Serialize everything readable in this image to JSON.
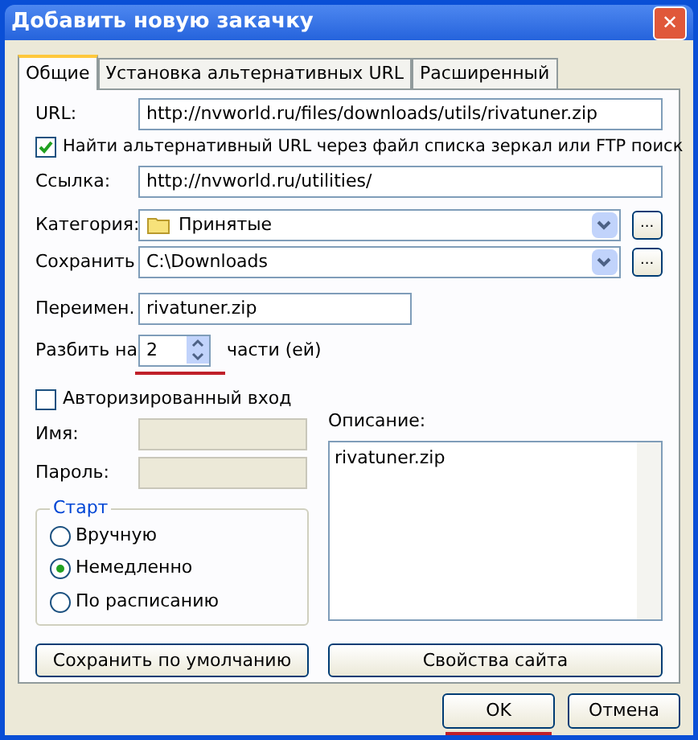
{
  "window": {
    "title": "Добавить новую закачку",
    "close": "✕"
  },
  "tabs": [
    {
      "label": "Общие",
      "selected": true
    },
    {
      "label": "Установка альтернативных URL",
      "selected": false
    },
    {
      "label": "Расширенный",
      "selected": false
    }
  ],
  "url": {
    "label": "URL:",
    "value": "http://nvworld.ru/files/downloads/utils/rivatuner.zip"
  },
  "find_alternative": {
    "label": "Найти альтернативный URL через файл списка зеркал или FTP поиск",
    "checked": true
  },
  "link": {
    "label": "Ссылка:",
    "value": "http://nvworld.ru/utilities/"
  },
  "category": {
    "label": "Категория:",
    "value": "Принятые",
    "browse": "..."
  },
  "save_to": {
    "label": "Сохранить",
    "value": "C:\\Downloads",
    "browse": "..."
  },
  "rename": {
    "label": "Переимен.",
    "value": "rivatuner.zip"
  },
  "split": {
    "label": "Разбить на",
    "value": "2",
    "suffix": "части (ей)"
  },
  "auth": {
    "label": "Авторизированный вход",
    "checked": false
  },
  "name": {
    "label": "Имя:",
    "disabled": true
  },
  "password": {
    "label": "Пароль:",
    "disabled": true
  },
  "start": {
    "title": "Старт",
    "options": [
      {
        "label": "Вручную",
        "selected": false
      },
      {
        "label": "Немедленно",
        "selected": true
      },
      {
        "label": "По расписанию",
        "selected": false
      }
    ]
  },
  "description": {
    "label": "Описание:",
    "value": "rivatuner.zip"
  },
  "panel_buttons": [
    "Сохранить по умолчанию",
    "Свойства сайта"
  ],
  "dialog_buttons": [
    "OK",
    "Отмена"
  ]
}
